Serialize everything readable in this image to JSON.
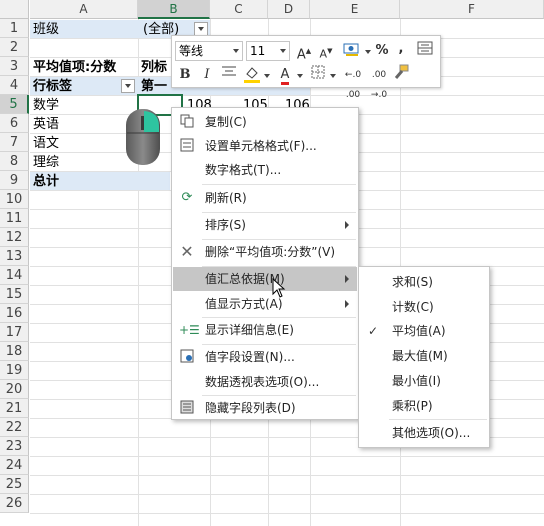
{
  "columns": [
    "A",
    "B",
    "C",
    "D",
    "E",
    "F"
  ],
  "rows": [
    "1",
    "2",
    "3",
    "4",
    "5",
    "6",
    "7",
    "8",
    "9",
    "10",
    "11",
    "12",
    "13",
    "14",
    "15",
    "16",
    "17",
    "18",
    "19",
    "20",
    "21",
    "22",
    "23",
    "24",
    "25",
    "26"
  ],
  "cells": {
    "a1": "班级",
    "b1": "(全部)",
    "a3": "平均值项:分数",
    "b3": "列标",
    "a4": "行标签",
    "b4": "第一",
    "a5": "数学",
    "a6": "英语",
    "a7": "语文",
    "a8": "理综",
    "a9": "总计",
    "b5": "108",
    "c5": "105",
    "d5": "106"
  },
  "minibar": {
    "font": "等线",
    "size": "11",
    "grow": "A",
    "shrink": "A",
    "percent": "%",
    "comma": ",",
    "bold": "B",
    "italic": "I",
    "font_color": "A",
    "inc_decimal": "←.0 .00",
    "dec_decimal": ".00 →.0"
  },
  "context_menu": [
    {
      "label": "复制(C)",
      "icon": "copy-icon"
    },
    {
      "label": "设置单元格格式(F)...",
      "icon": "format-cells-icon"
    },
    {
      "label": "数字格式(T)...",
      "icon": ""
    },
    {
      "label": "刷新(R)",
      "icon": "refresh-icon"
    },
    {
      "label": "排序(S)",
      "icon": ""
    },
    {
      "label": "删除“平均值项:分数”(V)",
      "icon": "delete-x-icon"
    },
    {
      "label": "值汇总依据(M)",
      "icon": ""
    },
    {
      "label": "值显示方式(A)",
      "icon": ""
    },
    {
      "label": "显示详细信息(E)",
      "icon": "show-details-icon"
    },
    {
      "label": "值字段设置(N)...",
      "icon": "field-settings-icon"
    },
    {
      "label": "数据透视表选项(O)...",
      "icon": ""
    },
    {
      "label": "隐藏字段列表(D)",
      "icon": "field-list-icon"
    }
  ],
  "submenu": [
    {
      "label": "求和(S)"
    },
    {
      "label": "计数(C)"
    },
    {
      "label": "平均值(A)",
      "checked": true
    },
    {
      "label": "最大值(M)"
    },
    {
      "label": "最小值(I)"
    },
    {
      "label": "乘积(P)"
    },
    {
      "label": "其他选项(O)..."
    }
  ],
  "colors": {
    "accent": "#217346",
    "pivot_band": "#dde9f6",
    "highlight": "#c6c6c6"
  }
}
